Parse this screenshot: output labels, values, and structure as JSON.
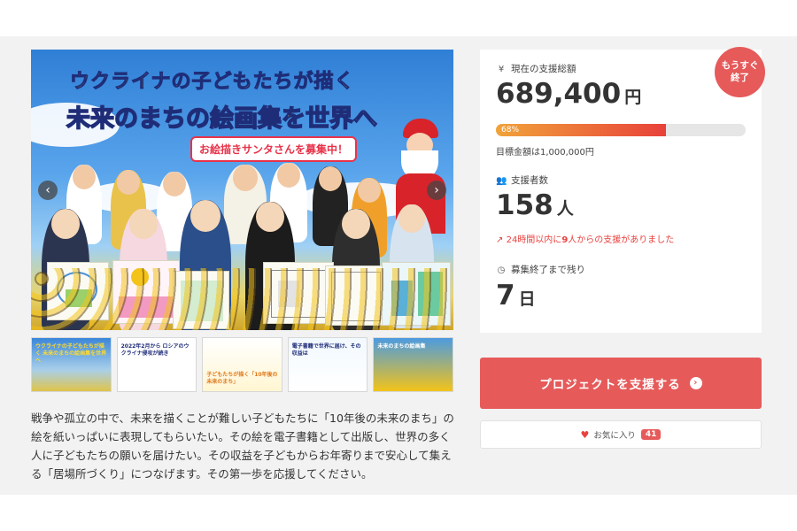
{
  "hero": {
    "title_line1": "ウクライナの子どもたちが描く",
    "title_line2_a": "未来のまちの絵画集",
    "title_line2_b": "を",
    "title_line2_c": "世界へ",
    "santa_banner": "お絵描きサンタさんを募集中！"
  },
  "thumbnails": [
    {
      "caption": "ウクライナの子どもたちが描く 未来のまちの絵画集を世界へ"
    },
    {
      "caption": "2022年2月から ロシアのウクライナ侵攻が続き"
    },
    {
      "caption": "子どもたちが描く「10年後の未来のまち」"
    },
    {
      "caption": "電子書籍で世界に届け、その収益は"
    },
    {
      "caption": "未来のまちの絵画集"
    }
  ],
  "description": "戦争や孤立の中で、未来を描くことが難しい子どもたちに「10年後の未来のまち」の絵を紙いっぱいに表現してもらいたい。その絵を電子書籍として出版し、世界の多く人に子どもたちの願いを届けたい。その収益を子どもからお年寄りまで安心して集える「居場所づくり」につなげます。その第一歩を応援してください。",
  "stats": {
    "badge": "もうすぐ終了",
    "badge_line1": "もうすぐ",
    "badge_line2": "終了",
    "amount_label": "現在の支援総額",
    "amount_value": "689,400",
    "amount_unit": "円",
    "progress_percent": 68,
    "progress_label": "68%",
    "goal_text": "目標金額は1,000,000円",
    "supporters_label": "支援者数",
    "supporters_value": "158",
    "supporters_unit": "人",
    "recent_prefix": "24時間以内に",
    "recent_count": "9",
    "recent_suffix": "人からの支援がありました",
    "remaining_label": "募集終了まで残り",
    "remaining_value": "7",
    "remaining_unit": "日"
  },
  "buttons": {
    "support_label": "プロジェクトを支援する",
    "favorite_label": "お気に入り",
    "favorite_count": "41"
  },
  "icons": {
    "amount": "yen-icon",
    "supporters": "users-icon",
    "recent": "trend-up-icon",
    "remaining": "clock-icon",
    "favorite": "heart-icon"
  },
  "colors": {
    "accent": "#e65a5a",
    "progress_start": "#f1a33a",
    "progress_end": "#e8413a"
  }
}
